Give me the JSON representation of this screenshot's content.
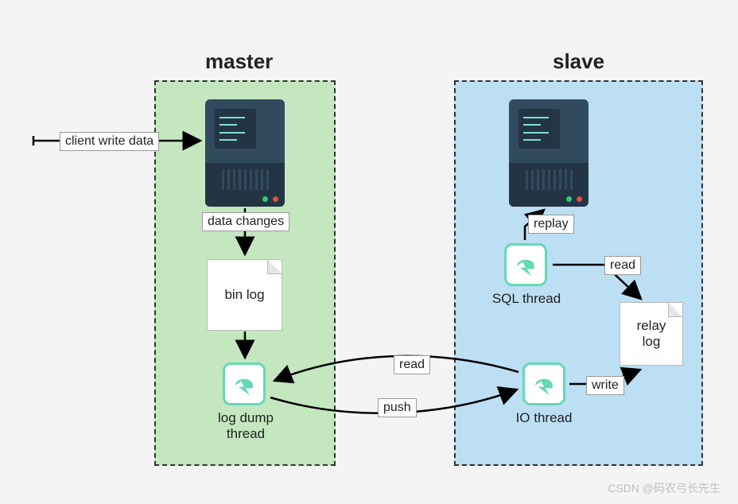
{
  "titles": {
    "master": "master",
    "slave": "slave"
  },
  "labels": {
    "client_write": "client write data",
    "data_changes": "data changes",
    "read": "read",
    "push": "push",
    "write": "write",
    "replay": "replay"
  },
  "nodes": {
    "bin_log": "bin log",
    "log_dump_thread": "log dump\nthread",
    "io_thread": "IO thread",
    "sql_thread": "SQL thread",
    "relay_log": "relay\nlog"
  },
  "colors": {
    "master_bg": "#c4e7c0",
    "slave_bg": "#bcdff3",
    "thread_accent": "#63d9b6",
    "server_body": "#314a5e"
  },
  "watermark": "CSDN @码农弓长先生"
}
